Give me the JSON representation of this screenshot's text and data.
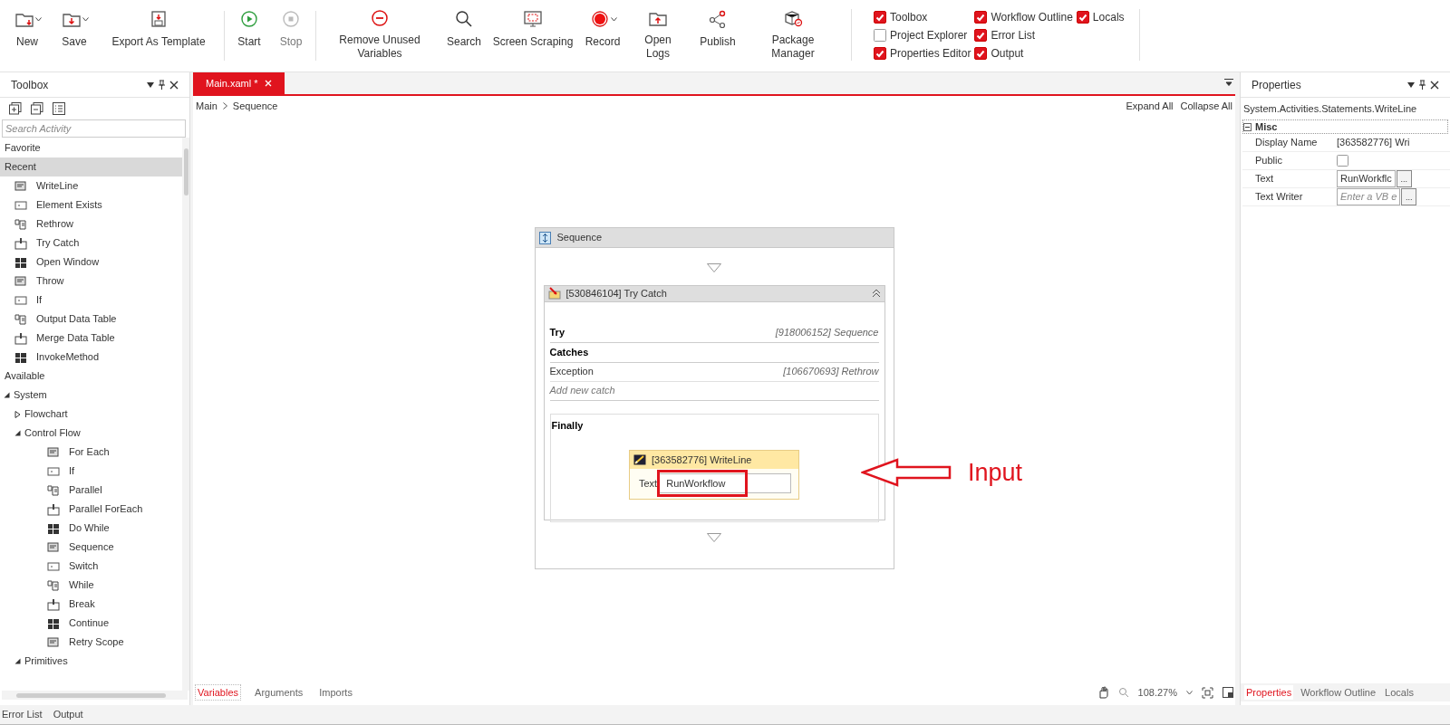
{
  "toolbar": {
    "groups": [
      {
        "buttons": [
          {
            "label": "New",
            "dropdown": true
          },
          {
            "label": "Save",
            "dropdown": true
          },
          {
            "label": "Export As Template",
            "dropdown": false
          }
        ]
      },
      {
        "buttons": [
          {
            "label": "Start",
            "dropdown": false,
            "disabled": false
          },
          {
            "label": "Stop",
            "dropdown": false,
            "disabled": true
          }
        ]
      },
      {
        "buttons": [
          {
            "label": "Remove Unused Variables",
            "dropdown": false
          },
          {
            "label": "Search",
            "dropdown": false
          },
          {
            "label": "Screen Scraping",
            "dropdown": false
          },
          {
            "label": "Record",
            "dropdown": true
          },
          {
            "label": "Open Logs",
            "dropdown": false
          },
          {
            "label": "Publish",
            "dropdown": false
          },
          {
            "label": "Package Manager",
            "dropdown": false
          }
        ]
      }
    ],
    "panel_toggles": [
      {
        "label": "Toolbox",
        "checked": true
      },
      {
        "label": "Workflow Outline",
        "checked": true
      },
      {
        "label": "Locals",
        "checked": true
      },
      {
        "label": "Project Explorer",
        "checked": false
      },
      {
        "label": "Error List",
        "checked": true
      },
      {
        "label": "Properties Editor",
        "checked": true
      },
      {
        "label": "Output",
        "checked": true
      }
    ]
  },
  "toolbox": {
    "title": "Toolbox",
    "search_placeholder": "Search Activity",
    "sections": [
      {
        "label": "Favorite",
        "selected": false
      },
      {
        "label": "Recent",
        "selected": true,
        "children": [
          {
            "label": "WriteLine"
          },
          {
            "label": "Element Exists"
          },
          {
            "label": "Rethrow"
          },
          {
            "label": "Try Catch"
          },
          {
            "label": "Open Window"
          },
          {
            "label": "Throw"
          },
          {
            "label": "If"
          },
          {
            "label": "Output Data Table"
          },
          {
            "label": "Merge Data Table"
          },
          {
            "label": "InvokeMethod"
          }
        ]
      },
      {
        "label": "Available",
        "selected": false,
        "children": [
          {
            "label": "System",
            "expanded": true,
            "children": [
              {
                "label": "Flowchart",
                "expanded": false
              },
              {
                "label": "Control Flow",
                "expanded": true,
                "children": [
                  {
                    "label": "For Each"
                  },
                  {
                    "label": "If"
                  },
                  {
                    "label": "Parallel"
                  },
                  {
                    "label": "Parallel ForEach"
                  },
                  {
                    "label": "Do While"
                  },
                  {
                    "label": "Sequence"
                  },
                  {
                    "label": "Switch"
                  },
                  {
                    "label": "While"
                  },
                  {
                    "label": "Break"
                  },
                  {
                    "label": "Continue"
                  },
                  {
                    "label": "Retry Scope"
                  }
                ]
              },
              {
                "label": "Primitives",
                "expanded": true
              }
            ]
          }
        ]
      }
    ]
  },
  "editor": {
    "tabs": [
      {
        "label": "Main.xaml *",
        "selected": true
      }
    ],
    "breadcrumb": [
      "Main",
      "Sequence"
    ],
    "actions": [
      "Expand All",
      "Collapse All"
    ],
    "sequence": {
      "title": "Sequence",
      "try_catch": {
        "title": "[530846104] Try Catch",
        "try": {
          "label": "Try",
          "value": "[918006152] Sequence"
        },
        "catches_label": "Catches",
        "catches": [
          {
            "exception": "Exception",
            "handler": "[106670693] Rethrow"
          }
        ],
        "add_catch": "Add new catch",
        "finally": {
          "label": "Finally",
          "activity": {
            "title": "[363582776] WriteLine",
            "field_label": "Text",
            "value": "RunWorkflow"
          }
        }
      }
    },
    "annotation": {
      "label": "Input"
    },
    "bottom_tabs": [
      {
        "label": "Variables",
        "selected": true
      },
      {
        "label": "Arguments",
        "selected": false
      },
      {
        "label": "Imports",
        "selected": false
      }
    ],
    "zoom": "108.27%"
  },
  "properties": {
    "title": "Properties",
    "type": "System.Activities.Statements.WriteLine",
    "group": "Misc",
    "rows": [
      {
        "kind": "text",
        "name": "Display Name",
        "value": "[363582776] Wri"
      },
      {
        "kind": "checkbox",
        "name": "Public",
        "checked": false
      },
      {
        "kind": "field",
        "name": "Text",
        "value": "RunWorkflc",
        "button": "..."
      },
      {
        "kind": "field",
        "name": "Text Writer",
        "placeholder": "Enter a VB e",
        "button": "..."
      }
    ],
    "bottom_tabs": [
      {
        "label": "Properties",
        "selected": true
      },
      {
        "label": "Workflow Outline",
        "selected": false
      },
      {
        "label": "Locals",
        "selected": false
      }
    ]
  },
  "output_tabs": [
    {
      "label": "Error List"
    },
    {
      "label": "Output"
    }
  ]
}
